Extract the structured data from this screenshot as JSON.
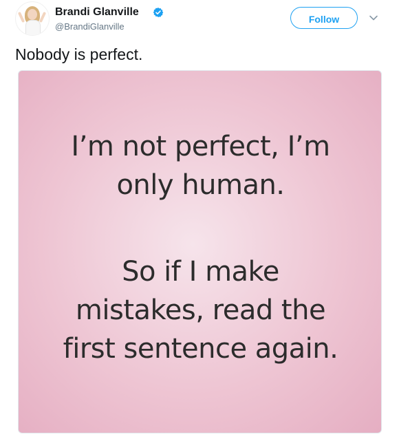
{
  "tweet": {
    "author": {
      "name": "Brandi Glanville",
      "handle": "@BrandiGlanville",
      "verified": true
    },
    "follow_label": "Follow",
    "text": "Nobody is perfect.",
    "media": {
      "quote_lines": [
        "I’m not perfect, I’m",
        "only human.",
        "So if I make",
        "mistakes, read the",
        "first sentence again."
      ]
    }
  },
  "colors": {
    "accent": "#1da1f2",
    "text_primary": "#14171a",
    "text_secondary": "#657786",
    "image_pink": "#eec5d3"
  },
  "icons": {
    "verified": "verified-badge-icon",
    "caret": "chevron-down-icon"
  }
}
